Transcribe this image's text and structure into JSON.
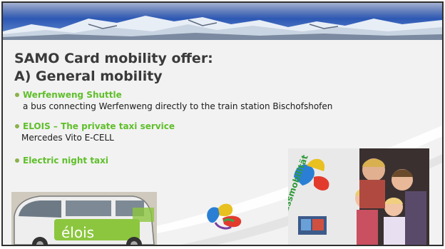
{
  "slide": {
    "title_line1": "SAMO Card mobility offer:",
    "title_line2": "A) General mobility",
    "bullets": [
      {
        "heading": "Werfenweng Shuttle",
        "text": "a bus connecting Werfenweng directly to the train station Bischofshofen"
      },
      {
        "heading": "ELOIS – The private taxi service",
        "text": "Mercedes Vito E-CELL"
      },
      {
        "heading": "Electric night taxi",
        "text": ""
      }
    ],
    "van_logo_text": "élois",
    "family_van_text": "genussmobilität"
  },
  "colors": {
    "heading_green": "#5fbf2a",
    "bullet_dot": "#8ab24a",
    "title_gray": "#3a3a3a",
    "banner_sky": "#2f5bb6"
  },
  "icons": [
    "mountain-banner",
    "butterfly-logo"
  ]
}
